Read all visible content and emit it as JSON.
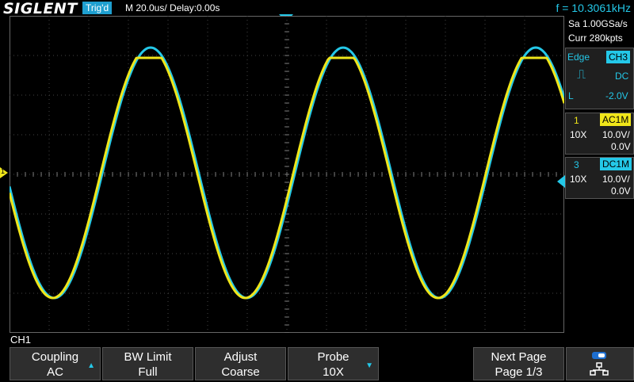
{
  "header": {
    "logo": "SIGLENT",
    "trigger_status": "Trig'd",
    "timebase": "M 20.0us/  Delay:0.00s",
    "frequency": "f = 10.3061kHz"
  },
  "acquisition": {
    "sample_rate": "Sa 1.00GSa/s",
    "memory": "Curr 280kpts"
  },
  "trigger_panel": {
    "type": "Edge",
    "source": "CH3",
    "coupling": "DC",
    "level_label": "L",
    "level": "-2.0V"
  },
  "channel1": {
    "number": "1",
    "coupling": "AC1M",
    "probe": "10X",
    "scale": "10.0V/",
    "offset": "0.0V",
    "marker": "1",
    "color": "#f0e61a"
  },
  "channel3": {
    "number": "3",
    "coupling": "DC1M",
    "probe": "10X",
    "scale": "10.0V/",
    "offset": "0.0V",
    "color": "#24c8e8"
  },
  "menu_title": "CH1",
  "softkeys": [
    {
      "line1": "Coupling",
      "line2": "AC",
      "arrow": "▲"
    },
    {
      "line1": "BW Limit",
      "line2": "Full",
      "arrow": ""
    },
    {
      "line1": "Adjust",
      "line2": "Coarse",
      "arrow": ""
    },
    {
      "line1": "Probe",
      "line2": "10X",
      "arrow": "▼"
    },
    {
      "line1": "Next Page",
      "line2": "Page 1/3",
      "arrow": ""
    }
  ],
  "icons": {
    "status": "usb-network-icon"
  }
}
